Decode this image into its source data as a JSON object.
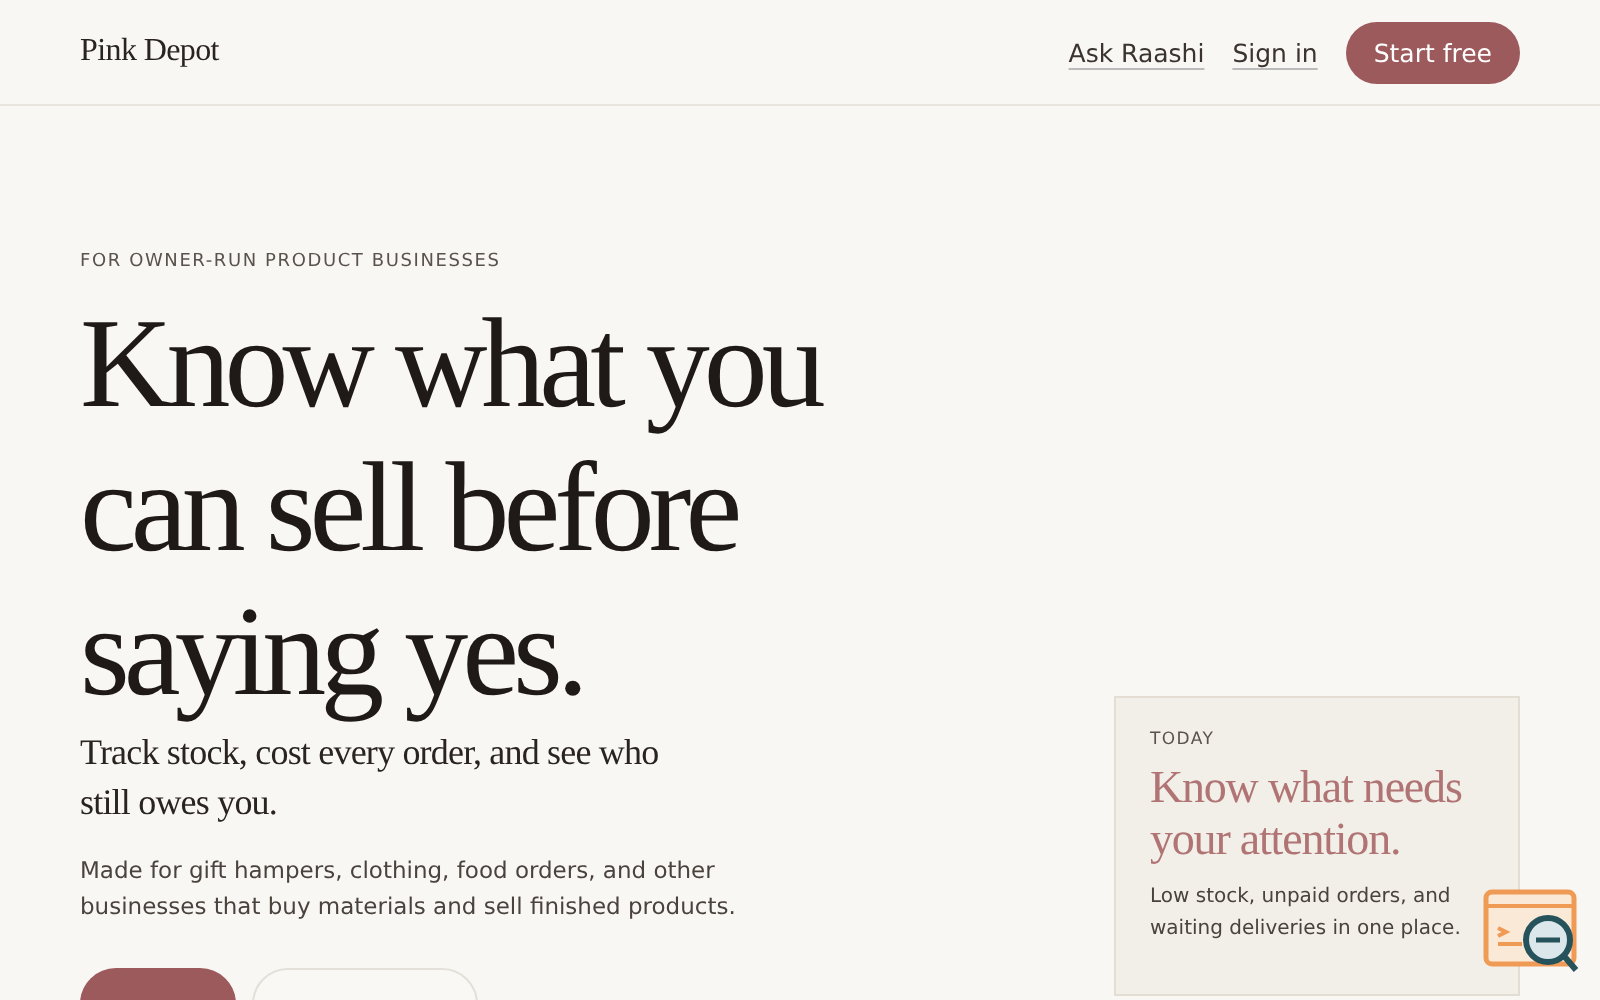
{
  "nav": {
    "brand": "Pink Depot",
    "links": [
      "Ask Raashi",
      "Sign in"
    ],
    "cta": "Start free"
  },
  "hero": {
    "eyebrow": "FOR OWNER-RUN PRODUCT BUSINESSES",
    "title_lines": [
      "Know what you",
      "can sell before",
      "saying yes."
    ],
    "subtitle": "Track stock, cost every order, and see who still owes you.",
    "body": "Made for gift hampers, clothing, food orders, and other businesses that buy materials and sell finished products.",
    "buttons": [
      {
        "kind": "primary"
      },
      {
        "kind": "secondary"
      }
    ]
  },
  "card": {
    "eyebrow": "TODAY",
    "title": "Know what needs your attention.",
    "body": "Low stock, unpaid orders, and waiting deliveries in one place."
  }
}
